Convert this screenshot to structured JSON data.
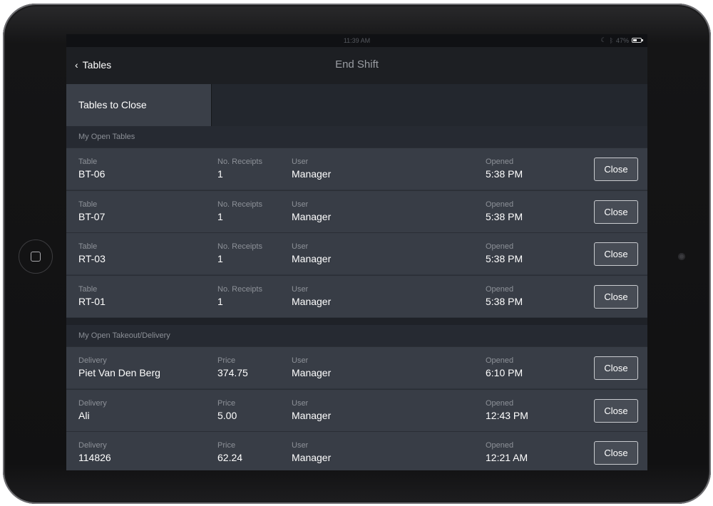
{
  "status_bar": {
    "time": "11:39 AM",
    "battery_percent": "47%"
  },
  "nav": {
    "back_label": "Tables",
    "title": "End Shift"
  },
  "tabs": [
    {
      "label": "Tables to Close"
    }
  ],
  "sections": {
    "tables": {
      "header": "My Open Tables",
      "rows": [
        {
          "label1": "Table",
          "value1": "BT-06",
          "label2": "No. Receipts",
          "value2": "1",
          "user_label": "User",
          "user": "Manager",
          "opened_label": "Opened",
          "opened": "5:38 PM",
          "button": "Close"
        },
        {
          "label1": "Table",
          "value1": "BT-07",
          "label2": "No. Receipts",
          "value2": "1",
          "user_label": "User",
          "user": "Manager",
          "opened_label": "Opened",
          "opened": "5:38 PM",
          "button": "Close"
        },
        {
          "label1": "Table",
          "value1": "RT-03",
          "label2": "No. Receipts",
          "value2": "1",
          "user_label": "User",
          "user": "Manager",
          "opened_label": "Opened",
          "opened": "5:38 PM",
          "button": "Close"
        },
        {
          "label1": "Table",
          "value1": "RT-01",
          "label2": "No. Receipts",
          "value2": "1",
          "user_label": "User",
          "user": "Manager",
          "opened_label": "Opened",
          "opened": "5:38 PM",
          "button": "Close"
        }
      ]
    },
    "takeout": {
      "header": "My Open Takeout/Delivery",
      "rows": [
        {
          "label1": "Delivery",
          "value1": "Piet Van Den Berg",
          "label2": "Price",
          "value2": "374.75",
          "user_label": "User",
          "user": "Manager",
          "opened_label": "Opened",
          "opened": "6:10 PM",
          "button": "Close"
        },
        {
          "label1": "Delivery",
          "value1": "Ali",
          "label2": "Price",
          "value2": "5.00",
          "user_label": "User",
          "user": "Manager",
          "opened_label": "Opened",
          "opened": "12:43 PM",
          "button": "Close"
        },
        {
          "label1": "Delivery",
          "value1": "114826",
          "label2": "Price",
          "value2": "62.24",
          "user_label": "User",
          "user": "Manager",
          "opened_label": "Opened",
          "opened": "12:21 AM",
          "button": "Close"
        }
      ]
    }
  },
  "colors": {
    "screen_bg": "#2f343d",
    "row_bg": "#383d46",
    "nav_bg": "#1d1f23",
    "active_tab_bg": "#3a3f48"
  }
}
